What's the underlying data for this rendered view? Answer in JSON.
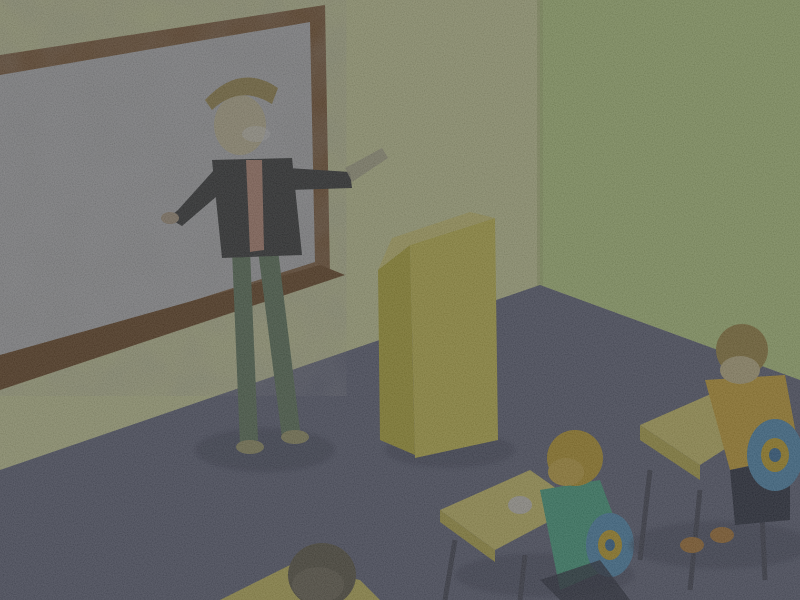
{
  "scene": {
    "kind": "isometric classroom",
    "characters": [
      "teacher",
      "student",
      "student",
      "student"
    ],
    "props": [
      "chalkboard",
      "lectern",
      "school-desk",
      "school-desk",
      "backpack",
      "backpack"
    ]
  },
  "colors": {
    "left_wall": "#f2f7b7",
    "right_wall": "#d9f59a",
    "floor": "#6f7490",
    "board_frame": "#8b5a2b",
    "board_surface": "#d9dadf",
    "lectern": "#eee25a",
    "teacher_jacket": "#3a3d3e",
    "teacher_pants": "#6c8a6a",
    "teacher_hair": "#b6a05a",
    "desk_top": "#f4e77a",
    "student_shirt_a": "#4fc19a",
    "student_shirt_b": "#f2c23a",
    "backpack": "#5aa5d8",
    "student_hair": "#e0b830"
  }
}
